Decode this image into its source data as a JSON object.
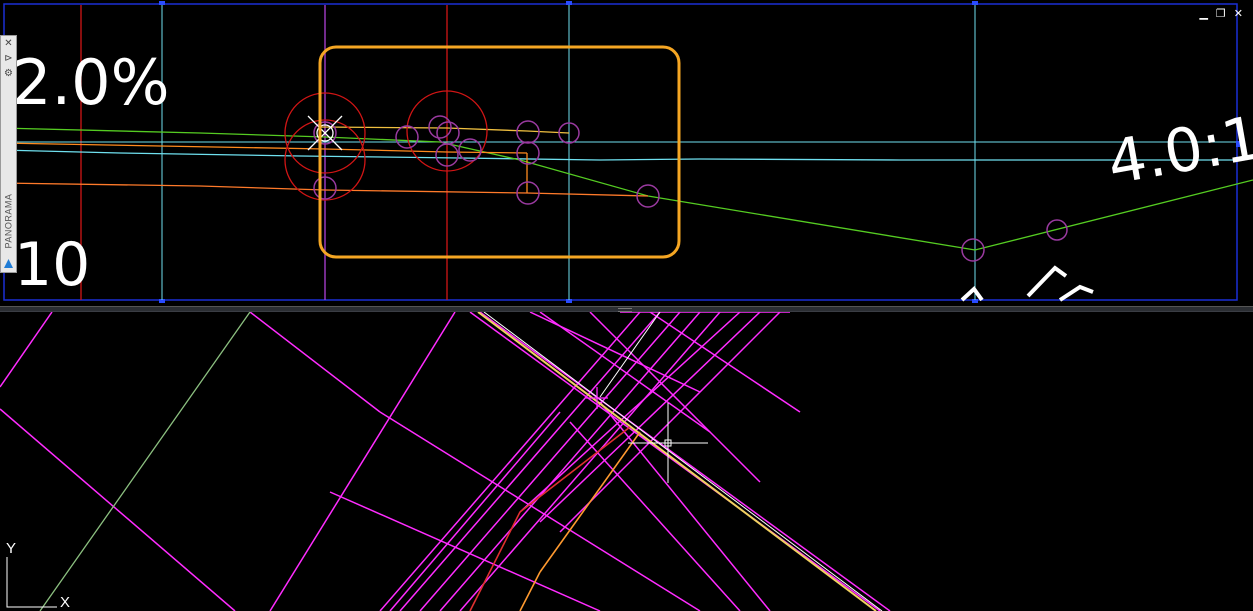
{
  "top_view": {
    "annotations": {
      "grade_percent": "2.0%",
      "left_number": "10",
      "slope_ratio": "4.0:1"
    },
    "window_controls": {
      "minimize": "▁",
      "restore": "❐",
      "close": "✕"
    }
  },
  "panorama_palette": {
    "title": "PANORAMA",
    "close_glyph": "✕",
    "pin_glyph": "⊳",
    "settings_glyph": "⚙"
  },
  "bottom_view": {
    "ucs": {
      "x_label": "X",
      "y_label": "Y"
    }
  },
  "colors": {
    "background": "#000000",
    "viewport_border": "#1a2fd6",
    "magenta": "#ff2cff",
    "cyan": "#6fe0ef",
    "red": "#d01515",
    "orange": "#ff8a1e",
    "yellow": "#f0c040",
    "green": "#55cc22",
    "selection_box": "#f5a623",
    "purple_marker": "#9a3aa0"
  }
}
